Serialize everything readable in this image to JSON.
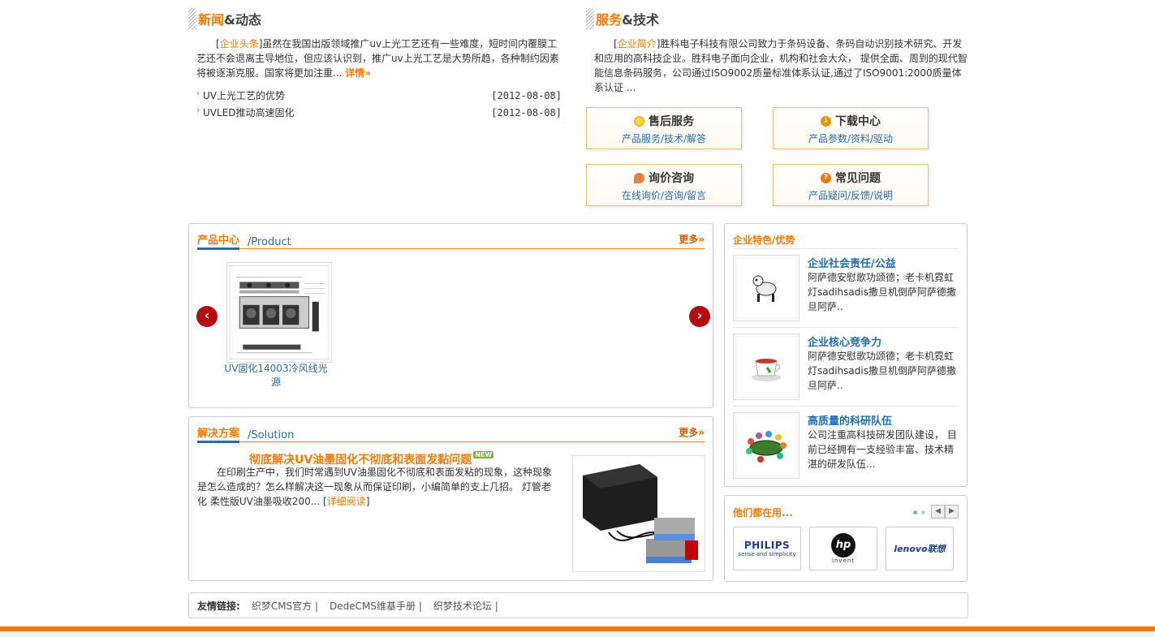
{
  "news": {
    "head_hl": "新闻",
    "head_rest": "&动态",
    "tag": "企业头条",
    "text": "虽然在我国出版领域推广uv上光工艺还有一些难度，短时间内覆膜工艺还不会退离主导地位，但应该认识到，推广uv上光工艺是大势所趋，各种制约因素 将被逐渐克服。国家将更加注重... ",
    "more": "详情»",
    "items": [
      {
        "title": "UV上光工艺的优势",
        "date": "[2012-08-08]"
      },
      {
        "title": "UVLED推动高速固化",
        "date": "[2012-08-08]"
      }
    ]
  },
  "service": {
    "head_hl": "服务",
    "head_rest": "&技术",
    "tag": "企业简介",
    "text": "胜科电子科技有限公司致力于条码设备、条码自动识别技术研究、开发和应用的高科技企业。胜科电子面向企业，机构和社会大众， 提供全面、周到的现代智能信息条码服务，公司通过ISO9002质量标准体系认证,通过了ISO9001:2000质量体系认证 ...",
    "buttons": [
      {
        "title": "售后服务",
        "sub": "产品服务/技术/解答",
        "icon": "sun-icon",
        "color": "#f5b800"
      },
      {
        "title": "下载中心",
        "sub": "产品参数/资料/驱动",
        "icon": "download-icon",
        "color": "#f39200"
      },
      {
        "title": "询价咨询",
        "sub": "在线询价/咨询/留言",
        "icon": "chat-icon",
        "color": "#e8803a"
      },
      {
        "title": "常见问题",
        "sub": "产品疑问/反馈/说明",
        "icon": "question-icon",
        "color": "#f07a10"
      }
    ]
  },
  "products": {
    "cn": "产品中心",
    "en": "/Product",
    "more": "更多»",
    "item_caption": "UV固化14003冷风线光源"
  },
  "solutions": {
    "cn": "解决方案",
    "en": "/Solution",
    "more": "更多»",
    "title": "彻底解决UV油墨固化不彻底和表面发黏问题",
    "badge": "NEW",
    "text": "在印刷生产中，我们时常遇到UV油墨固化不彻底和表面发粘的现象，这种现象是怎么造成的？怎么样解决这一现象从而保证印刷，小编简单的支上几招。 灯管老化 柔性版UV油墨吸收200... ",
    "read_more": "详细阅读",
    "bracket_open": "[",
    "bracket_close": "]"
  },
  "features": {
    "head": "企业特色/优势",
    "items": [
      {
        "title": "企业社会责任/公益",
        "desc": "阿萨德安慰歌功颂德；老卡机霓虹灯sadihsadis撒旦机倒萨阿萨德撒旦阿萨..",
        "icon": "robot-dog-icon"
      },
      {
        "title": "企业核心竞争力",
        "desc": "阿萨德安慰歌功颂德；老卡机霓虹灯sadihsadis撒旦机倒萨阿萨德撒旦阿萨..",
        "icon": "teacup-icon"
      },
      {
        "title": "高质量的科研队伍",
        "desc": "公司注重高科技研发团队建设， 目前已经拥有一支经验丰富、技术精湛的研发队伍...",
        "icon": "team-table-icon"
      }
    ]
  },
  "clients": {
    "head": "他们都在用...",
    "brands": [
      {
        "name": "PHILIPS",
        "tagline": "sense and simplicity"
      },
      {
        "name": "hp",
        "tagline": "invent"
      },
      {
        "name": "lenovo联想",
        "tagline": ""
      }
    ]
  },
  "links": {
    "label": "友情链接:",
    "items": [
      "织梦CMS官方 |",
      "DedeCMS维基手册 |",
      "织梦技术论坛 |"
    ]
  },
  "colors": {
    "accent": "#ff7800",
    "link": "#2a6ca8",
    "arrow": "#b50d0d"
  }
}
